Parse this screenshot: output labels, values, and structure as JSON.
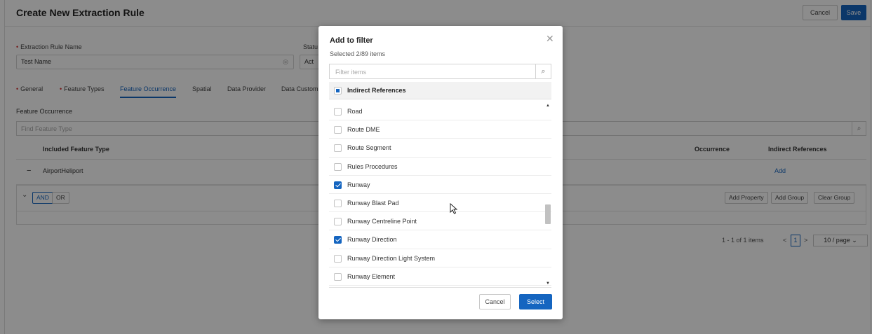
{
  "page": {
    "title": "Create New Extraction Rule",
    "cancel_label": "Cancel",
    "save_label": "Save"
  },
  "form": {
    "rule_name_label": "Extraction Rule Name",
    "rule_name_value": "Test Name",
    "status_label_partial": "Statu",
    "status_value_partial": "Act"
  },
  "tabs": [
    "General",
    "Feature Types",
    "Feature Occurrence",
    "Spatial",
    "Data Provider",
    "Data Custom"
  ],
  "active_tab": "Feature Occurrence",
  "section": {
    "label": "Feature Occurrence",
    "search_placeholder": "Find Feature Type"
  },
  "table": {
    "headers": {
      "included": "Included Feature Type",
      "occurrence": "Occurrence",
      "indirect": "Indirect References"
    },
    "row": {
      "collapse": "−",
      "feature": "AirportHeliport",
      "add_link": "Add"
    }
  },
  "group": {
    "chevron": "⌄",
    "and_label": "AND",
    "or_label": "OR",
    "add_property": "Add Property",
    "add_group": "Add Group",
    "clear_group": "Clear Group"
  },
  "pagination": {
    "summary": "1 - 1 of 1 items",
    "prev": "<",
    "current": "1",
    "next": ">",
    "per_page": "10 / page ⌄"
  },
  "modal": {
    "title": "Add to filter",
    "subtitle": "Selected 2/89 items",
    "search_placeholder": "Filter items",
    "group_label": "Indirect References",
    "items": [
      {
        "label": "Road",
        "checked": false
      },
      {
        "label": "Route DME",
        "checked": false
      },
      {
        "label": "Route Segment",
        "checked": false
      },
      {
        "label": "Rules Procedures",
        "checked": false
      },
      {
        "label": "Runway",
        "checked": true
      },
      {
        "label": "Runway Blast Pad",
        "checked": false
      },
      {
        "label": "Runway Centreline Point",
        "checked": false
      },
      {
        "label": "Runway Direction",
        "checked": true
      },
      {
        "label": "Runway Direction Light System",
        "checked": false
      },
      {
        "label": "Runway Element",
        "checked": false
      }
    ],
    "cancel_label": "Cancel",
    "select_label": "Select"
  },
  "colors": {
    "primary": "#1565c0",
    "required": "#d32f2f",
    "overlay": "rgba(0,0,0,0.45)"
  }
}
